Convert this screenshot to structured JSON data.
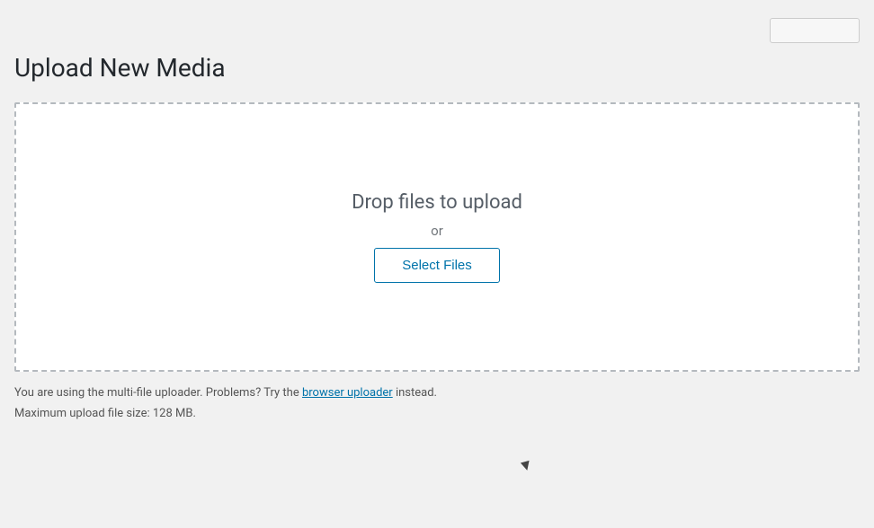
{
  "header": {
    "button_label": ""
  },
  "page": {
    "title": "Upload New Media"
  },
  "upload_area": {
    "drop_text": "Drop files to upload",
    "or_text": "or",
    "select_files_label": "Select Files"
  },
  "footer": {
    "info_text_prefix": "You are using the multi-file uploader. Problems? Try the ",
    "browser_uploader_link": "browser uploader",
    "info_text_suffix": " instead.",
    "max_size_text": "Maximum upload file size: 128 MB."
  }
}
